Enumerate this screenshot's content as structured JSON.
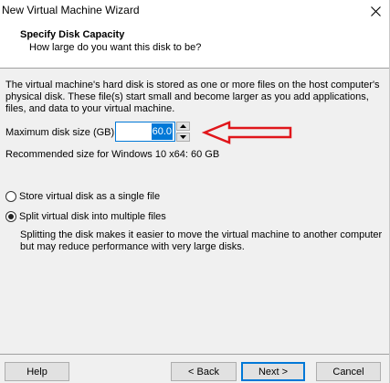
{
  "window": {
    "title": "New Virtual Machine Wizard",
    "close_glyph": "✕"
  },
  "header": {
    "title": "Specify Disk Capacity",
    "subtitle": "How large do you want this disk to be?"
  },
  "body": {
    "description_lines": [
      "The virtual machine's hard disk is stored as one or more files on the host computer's",
      "physical disk. These file(s) start small and become larger as you add applications,",
      "files, and data to your virtual machine."
    ],
    "max_size_label": "Maximum disk size (GB):",
    "max_size_value": "60.0",
    "recommended": "Recommended size for Windows 10 x64: 60 GB",
    "options": [
      {
        "label": "Store virtual disk as a single file",
        "selected": false
      },
      {
        "label": "Split virtual disk into multiple files",
        "selected": true
      }
    ],
    "split_description_lines": [
      "Splitting the disk makes it easier to move the virtual machine to another computer",
      "but may reduce performance with very large disks."
    ]
  },
  "annotation": {
    "arrow_color": "#e0161b"
  },
  "footer": {
    "help_label": "Help",
    "back_label": "< Back",
    "next_label": "Next >",
    "cancel_label": "Cancel"
  },
  "colors": {
    "accent": "#0078d7",
    "panel": "#f0f0f0"
  }
}
